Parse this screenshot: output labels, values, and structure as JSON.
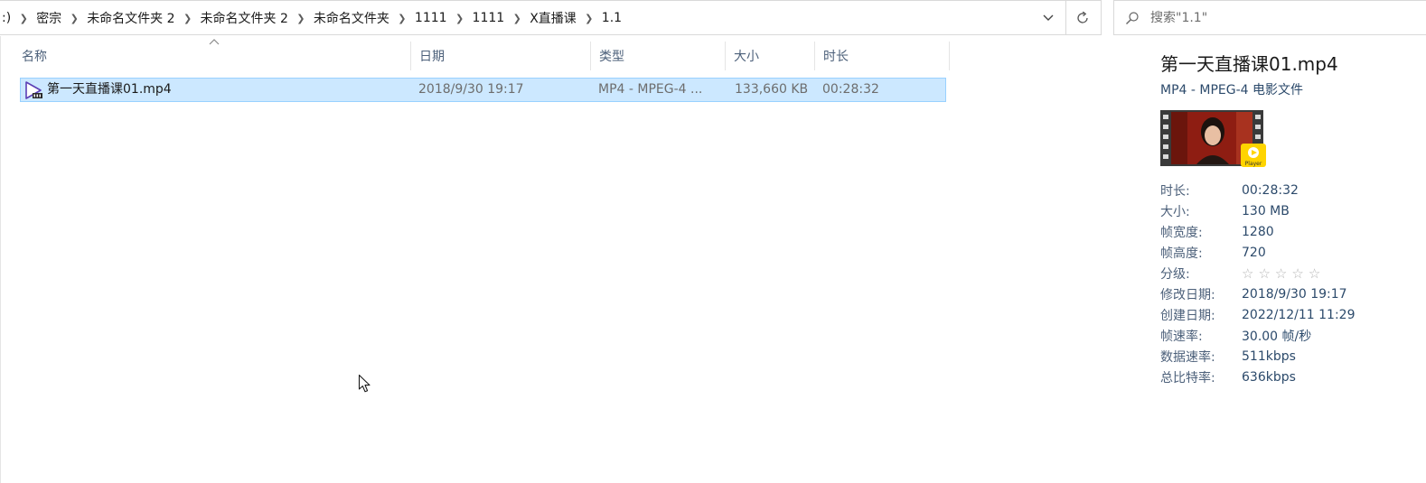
{
  "address_bar": {
    "breadcrumbs": [
      ":)",
      "密宗",
      "未命名文件夹 2",
      "未命名文件夹 2",
      "未命名文件夹",
      "1111",
      "1111",
      "X直播课",
      "1.1"
    ]
  },
  "search": {
    "placeholder": "搜索\"1.1\""
  },
  "columns": {
    "name": "名称",
    "date": "日期",
    "type": "类型",
    "size": "大小",
    "duration": "时长"
  },
  "files": [
    {
      "name": "第一天直播课01.mp4",
      "date": "2018/9/30 19:17",
      "type": "MP4 - MPEG-4 ...",
      "size": "133,660 KB",
      "duration": "00:28:32"
    }
  ],
  "details": {
    "title": "第一天直播课01.mp4",
    "subtitle": "MP4 - MPEG-4 电影文件",
    "thumbnail_badge": "Player",
    "rating": {
      "value": 0,
      "max": 5
    },
    "props": [
      {
        "label": "时长:",
        "value": "00:28:32"
      },
      {
        "label": "大小:",
        "value": "130 MB"
      },
      {
        "label": "帧宽度:",
        "value": "1280"
      },
      {
        "label": "帧高度:",
        "value": "720"
      },
      {
        "label": "分级:",
        "value": ""
      },
      {
        "label": "修改日期:",
        "value": "2018/9/30 19:17"
      },
      {
        "label": "创建日期:",
        "value": "2022/12/11 11:29"
      },
      {
        "label": "帧速率:",
        "value": "30.00 帧/秒"
      },
      {
        "label": "数据速率:",
        "value": "511kbps"
      },
      {
        "label": "总比特率:",
        "value": "636kbps"
      }
    ]
  },
  "colors": {
    "selection_bg": "#cce8ff",
    "selection_border": "#99d1ff",
    "header_text": "#4c607a",
    "detail_value": "#2c4a6b",
    "badge_yellow": "#ffd400"
  },
  "icons": [
    "chevron-right-icon",
    "chevron-down-icon",
    "refresh-icon",
    "search-icon",
    "sort-up-icon",
    "video-file-icon",
    "star-icon",
    "mouse-cursor-icon"
  ]
}
